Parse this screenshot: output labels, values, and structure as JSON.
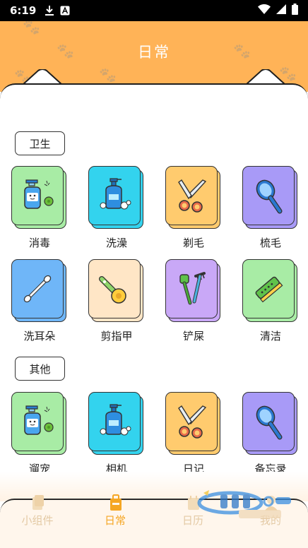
{
  "status_bar": {
    "time": "6:19"
  },
  "header": {
    "title": "日常"
  },
  "sections": [
    {
      "label": "卫生",
      "items": [
        {
          "label": "消毒",
          "icon": "sanitizer-virus-icon",
          "color": "#a8eca5"
        },
        {
          "label": "洗澡",
          "icon": "shampoo-bottle-icon",
          "color": "#33d3ee"
        },
        {
          "label": "剃毛",
          "icon": "scissors-icon",
          "color": "#ffcb6e"
        },
        {
          "label": "梳毛",
          "icon": "brush-icon",
          "color": "#a89af7"
        },
        {
          "label": "洗耳朵",
          "icon": "cotton-swab-icon",
          "color": "#6fb6f8"
        },
        {
          "label": "剪指甲",
          "icon": "nail-clipper-icon",
          "color": "#ffe6c6"
        },
        {
          "label": "铲屎",
          "icon": "shovel-rake-icon",
          "color": "#c9a8f7"
        },
        {
          "label": "清洁",
          "icon": "cleaning-brush-icon",
          "color": "#a8eca5"
        }
      ]
    },
    {
      "label": "其他",
      "items": [
        {
          "label": "遛宠",
          "icon": "sanitizer-virus-icon",
          "color": "#a8eca5"
        },
        {
          "label": "相机",
          "icon": "shampoo-bottle-icon",
          "color": "#33d3ee"
        },
        {
          "label": "日记",
          "icon": "scissors-icon",
          "color": "#ffcb6e"
        },
        {
          "label": "备忘录",
          "icon": "brush-icon",
          "color": "#a89af7"
        }
      ]
    }
  ],
  "bottom_nav": [
    {
      "label": "小组件",
      "active": false
    },
    {
      "label": "日常",
      "active": true
    },
    {
      "label": "日历",
      "active": false
    },
    {
      "label": "我的",
      "active": false
    }
  ],
  "colors": {
    "header_bg": "#ffb357",
    "active_nav": "#f5a623",
    "inactive_nav": "#e3c9a4"
  }
}
